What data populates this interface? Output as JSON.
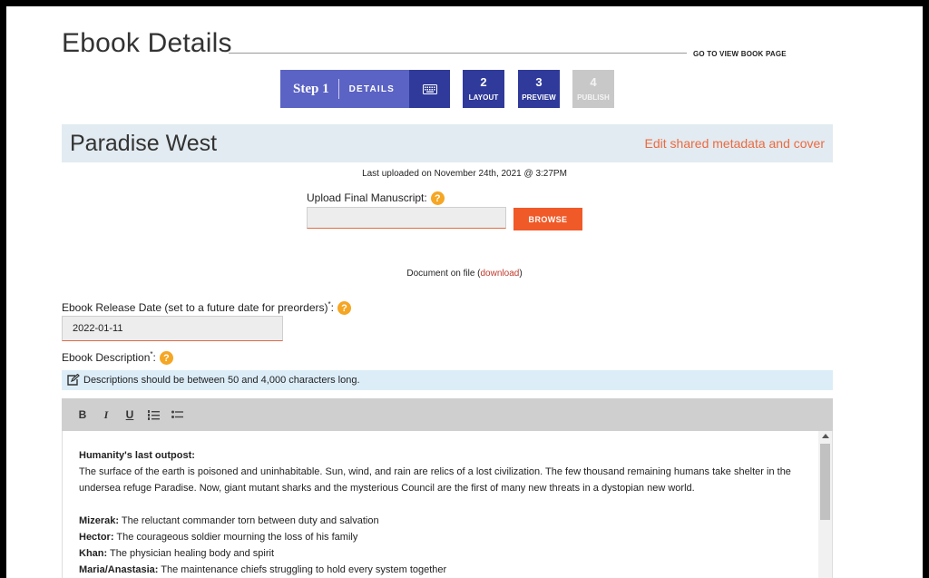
{
  "header": {
    "title": "Ebook Details",
    "view_link": "GO TO VIEW BOOK PAGE"
  },
  "stepper": {
    "step1_label": "Step 1",
    "step1_sub": "DETAILS",
    "step1_icon": "keyboard-icon",
    "steps": [
      {
        "num": "2",
        "label": "LAYOUT"
      },
      {
        "num": "3",
        "label": "PREVIEW"
      },
      {
        "num": "4",
        "label": "PUBLISH"
      }
    ]
  },
  "book": {
    "title": "Paradise West",
    "edit_link": "Edit shared metadata and cover"
  },
  "upload": {
    "last_uploaded": "Last uploaded on November 24th, 2021 @ 3:27PM",
    "label": "Upload Final Manuscript:",
    "browse_label": "BROWSE",
    "doc_prefix": "Document on file (",
    "doc_link": "download",
    "doc_suffix": ")"
  },
  "release": {
    "label": "Ebook Release Date (set to a future date for preorders)",
    "asterisk": "*",
    "colon": ":",
    "value": "2022-01-11"
  },
  "description": {
    "label": "Ebook Description",
    "asterisk": "*",
    "colon": ":",
    "info": "Descriptions should be between 50 and 4,000 characters long.",
    "toolbar": [
      "B",
      "I",
      "U"
    ],
    "heading": "Humanity's last outpost:",
    "paragraph": "The surface of the earth is poisoned and uninhabitable. Sun, wind, and rain are relics of a lost civilization. The few thousand remaining humans take shelter in the undersea refuge Paradise. Now, giant mutant sharks and the mysterious Council are the first of many new threats in a dystopian new world.",
    "characters": [
      {
        "name": "Mizerak:",
        "desc": " The reluctant commander torn between duty and salvation"
      },
      {
        "name": "Hector:",
        "desc": " The courageous soldier mourning the loss of his family"
      },
      {
        "name": "Khan:",
        "desc": " The physician healing body and spirit"
      },
      {
        "name": "Maria/Anastasia:",
        "desc": " The maintenance chiefs struggling to hold every system together"
      }
    ]
  },
  "help_glyph": "?",
  "colors": {
    "step_active_light": "#5b63c4",
    "step_active_dark": "#2f3a9a",
    "step_disabled": "#c8c8c8",
    "accent_orange": "#f05a28",
    "help_yellow": "#f5a623",
    "book_bar": "#e2ebf1",
    "info_bar": "#dcedf8"
  }
}
